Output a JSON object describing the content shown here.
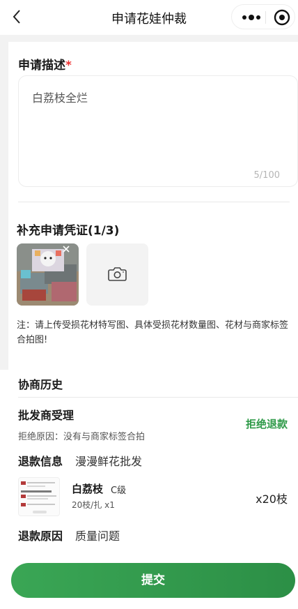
{
  "nav": {
    "title": "申请花娃仲裁"
  },
  "description": {
    "title": "申请描述",
    "required_mark": "*",
    "value": "白荔枝全烂",
    "counter": "5/100"
  },
  "evidence": {
    "title": "补充申请凭证(1/3)",
    "note": "注：请上传受损花材特写图、具体受损花材数量图、花材与商家标签合拍图!"
  },
  "history": {
    "title": "协商历史",
    "stage": "批发商受理",
    "status": "拒绝退款",
    "reason_text": "拒绝原因：没有与商家标签合拍",
    "refund_info_label": "退款信息",
    "refund_info_value": "漫漫鲜花批发",
    "product": {
      "name": "白荔枝",
      "grade": "C级",
      "spec": "20枝/扎 x1",
      "qty": "x20枝"
    },
    "refund_reason_label": "退款原因",
    "refund_reason_value": "质量问题"
  },
  "submit_label": "提交",
  "colors": {
    "accent": "#2e9a48",
    "required": "#e33333"
  }
}
